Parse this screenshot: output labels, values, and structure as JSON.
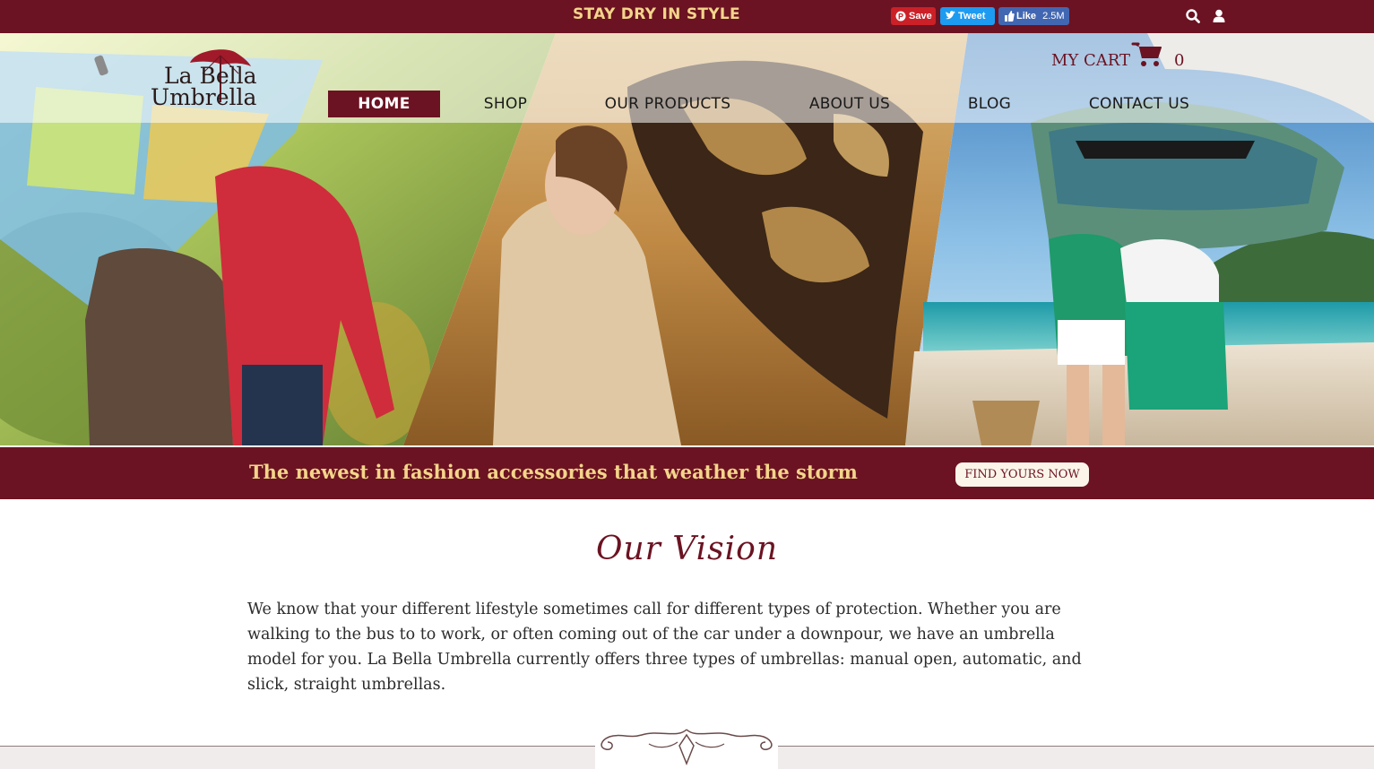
{
  "topbar": {
    "tagline": "STAY DRY IN STYLE",
    "social": {
      "pinterest_label": "Save",
      "twitter_label": "Tweet",
      "facebook_label": "Like",
      "facebook_count": "2.5M"
    }
  },
  "logo": {
    "line1": "La Bella",
    "line2": "Umbrella"
  },
  "cart": {
    "label": "MY CART",
    "count": "0"
  },
  "nav": {
    "items": [
      {
        "label": "HOME"
      },
      {
        "label": "SHOP"
      },
      {
        "label": "OUR PRODUCTS"
      },
      {
        "label": "ABOUT US"
      },
      {
        "label": "BLOG"
      },
      {
        "label": "CONTACT US"
      }
    ],
    "active_index": 0
  },
  "promo": {
    "text": "The newest in fashion accessories that weather the storm",
    "button_label": "FIND YOURS NOW"
  },
  "vision": {
    "title": "Our Vision",
    "body": "We know that your different lifestyle sometimes call for different types of protection. Whether you are walking to the bus to to work, or often coming out of the car under a downpour, we have an umbrella model for you. La Bella Umbrella currently offers three types of umbrellas: manual open, automatic, and slick, straight umbrellas."
  },
  "colors": {
    "brand": "#6b1322",
    "gold": "#f3d58a",
    "cream": "#fbf5e9"
  },
  "icons": [
    "search-icon",
    "user-icon",
    "cart-icon",
    "pinterest-icon",
    "twitter-icon",
    "facebook-icon",
    "umbrella-logo-icon",
    "ornament-flourish"
  ]
}
